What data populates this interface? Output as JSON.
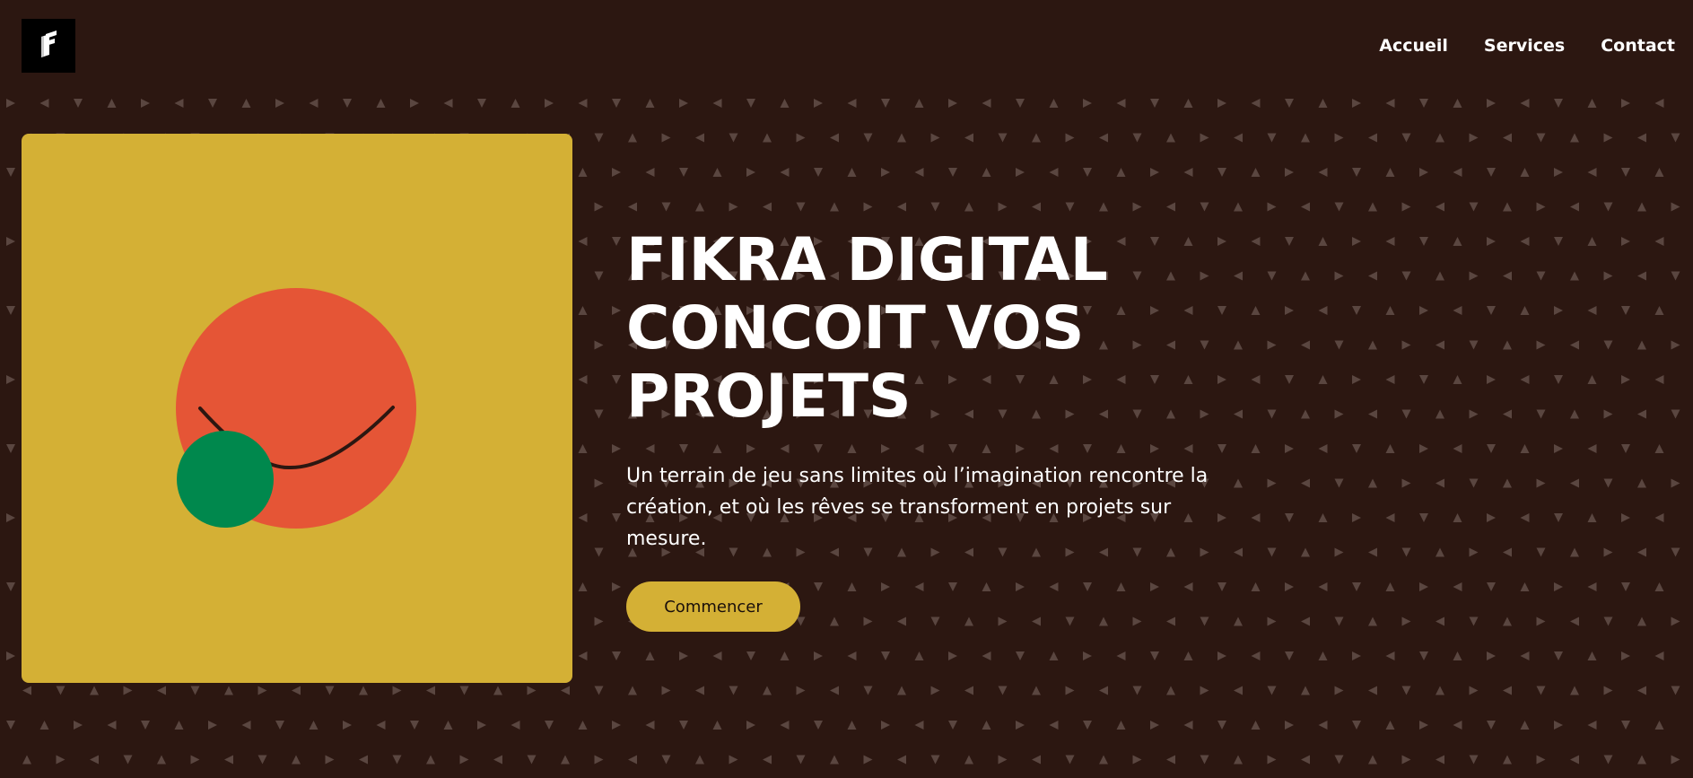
{
  "nav": {
    "logo_icon": "fikra-logo-icon",
    "items": [
      {
        "label": "Accueil"
      },
      {
        "label": "Services"
      },
      {
        "label": "Contact"
      }
    ]
  },
  "hero": {
    "title_lines": [
      "FIKRA DIGITAL",
      "CONCOIT VOS",
      "PROJETS"
    ],
    "description": "Un terrain de jeu sans limites où l’imagination rencontre la création, et où les rêves se transforment en projets sur mesure.",
    "cta_label": "Commencer",
    "illustration": "smiling-circle-illustration"
  },
  "colors": {
    "background": "#2c1711",
    "accent_yellow": "#d4b035",
    "circle_red": "#e55536",
    "circle_green": "#00884d",
    "pattern_triangle": "#5a4640"
  }
}
